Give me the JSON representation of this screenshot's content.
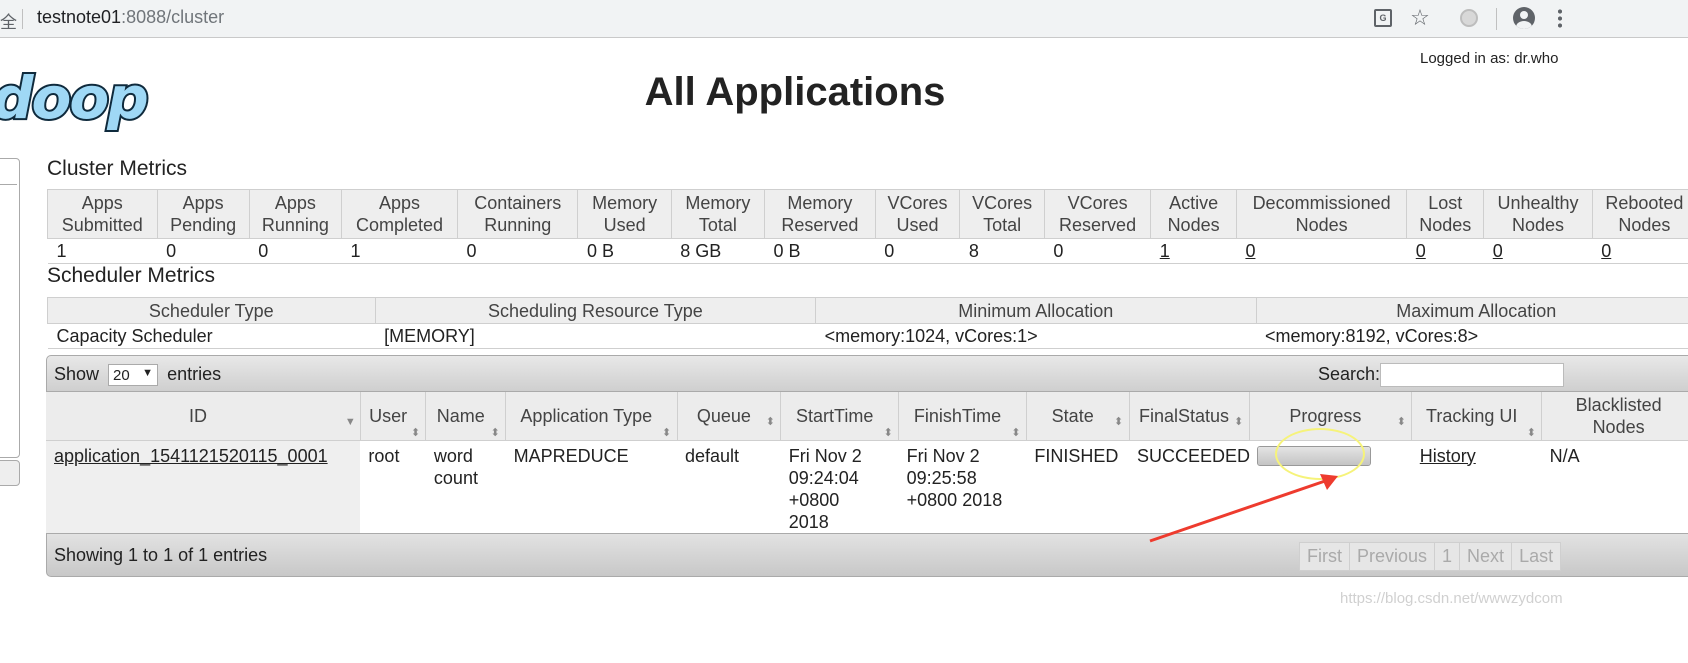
{
  "browser": {
    "secure_text": "全",
    "url_host": "testnote01",
    "url_rest": ":8088/cluster",
    "icons": [
      "translate-icon",
      "star-icon",
      "extension-icon",
      "profile-icon",
      "menu-icon"
    ]
  },
  "header": {
    "logged_in": "Logged in as: dr.who",
    "logo_text": "doop",
    "title": "All Applications"
  },
  "cluster_metrics": {
    "title": "Cluster Metrics",
    "headers": [
      [
        "Apps",
        "Submitted"
      ],
      [
        "Apps",
        "Pending"
      ],
      [
        "Apps",
        "Running"
      ],
      [
        "Apps",
        "Completed"
      ],
      [
        "Containers",
        "Running"
      ],
      [
        "Memory",
        "Used"
      ],
      [
        "Memory",
        "Total"
      ],
      [
        "Memory",
        "Reserved"
      ],
      [
        "VCores",
        "Used"
      ],
      [
        "VCores",
        "Total"
      ],
      [
        "VCores",
        "Reserved"
      ],
      [
        "Active",
        "Nodes"
      ],
      [
        "Decommissioned",
        "Nodes"
      ],
      [
        "Lost",
        "Nodes"
      ],
      [
        "Unhealthy",
        "Nodes"
      ],
      [
        "Rebooted",
        "Nodes"
      ]
    ],
    "values": [
      "1",
      "0",
      "0",
      "1",
      "0",
      "0 B",
      "8 GB",
      "0 B",
      "0",
      "8",
      "0",
      "1",
      "0",
      "0",
      "0",
      "0"
    ]
  },
  "scheduler_metrics": {
    "title": "Scheduler Metrics",
    "headers": [
      "Scheduler Type",
      "Scheduling Resource Type",
      "Minimum Allocation",
      "Maximum Allocation"
    ],
    "values": [
      "Capacity Scheduler",
      "[MEMORY]",
      "<memory:1024, vCores:1>",
      "<memory:8192, vCores:8>"
    ]
  },
  "apps_table": {
    "show_label": "Show",
    "entries_label": "entries",
    "page_size": "20",
    "search_label": "Search:",
    "search_value": "",
    "columns": [
      [
        "ID"
      ],
      [
        "User"
      ],
      [
        "Name"
      ],
      [
        "Application Type"
      ],
      [
        "Queue"
      ],
      [
        "StartTime"
      ],
      [
        "FinishTime"
      ],
      [
        "State"
      ],
      [
        "FinalStatus"
      ],
      [
        "Progress"
      ],
      [
        "Tracking UI"
      ],
      [
        "Blacklisted",
        "Nodes"
      ]
    ],
    "rows": [
      {
        "id": "application_1541121520115_0001",
        "user": "root",
        "name": [
          "word",
          "count"
        ],
        "app_type": "MAPREDUCE",
        "queue": "default",
        "start_time": [
          "Fri Nov 2",
          "09:24:04",
          "+0800",
          "2018"
        ],
        "finish_time": [
          "Fri Nov 2",
          "09:25:58",
          "+0800 2018"
        ],
        "state": "FINISHED",
        "final_status": "SUCCEEDED",
        "progress": 1.0,
        "tracking_ui": "History",
        "blacklisted_nodes": "N/A"
      }
    ],
    "info": "Showing 1 to 1 of 1 entries",
    "pager": [
      "First",
      "Previous",
      "1",
      "Next",
      "Last"
    ]
  },
  "watermark": "https://blog.csdn.net/wwwzydcom",
  "colors": {
    "highlight": "#f6f37a",
    "arrow": "#ee3b2e",
    "logo_fill": "#9fd8f5"
  }
}
